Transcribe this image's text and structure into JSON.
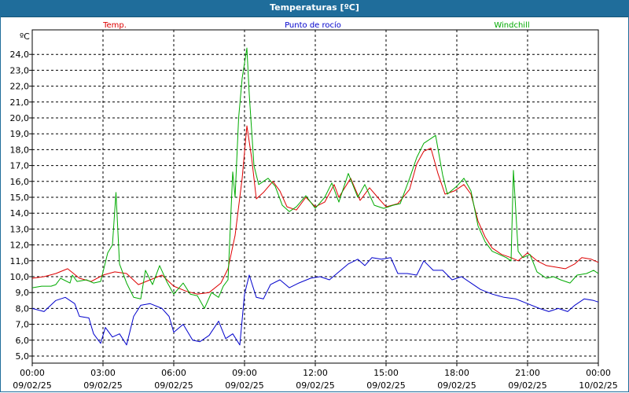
{
  "window": {
    "title": "Temperaturas [ºC]"
  },
  "chart_data": {
    "type": "line",
    "title": "Temperaturas [ºC]",
    "ylabel": "ºC",
    "ylim": [
      4.75,
      25.3
    ],
    "yticks": [
      "5,0",
      "6,0",
      "7,0",
      "8,0",
      "9,0",
      "10,0",
      "11,0",
      "12,0",
      "13,0",
      "14,0",
      "15,0",
      "16,0",
      "17,0",
      "18,0",
      "19,0",
      "20,0",
      "21,0",
      "22,0",
      "23,0",
      "24,0"
    ],
    "ytick_values": [
      5,
      6,
      7,
      8,
      9,
      10,
      11,
      12,
      13,
      14,
      15,
      16,
      17,
      18,
      19,
      20,
      21,
      22,
      23,
      24
    ],
    "xlim": [
      0,
      24
    ],
    "xtick_hours": [
      0,
      3,
      6,
      9,
      12,
      15,
      18,
      21,
      24
    ],
    "xticks": [
      {
        "time": "00:00",
        "date": "09/02/25"
      },
      {
        "time": "03:00",
        "date": "09/02/25"
      },
      {
        "time": "06:00",
        "date": "09/02/25"
      },
      {
        "time": "09:00",
        "date": "09/02/25"
      },
      {
        "time": "12:00",
        "date": "09/02/25"
      },
      {
        "time": "15:00",
        "date": "09/02/25"
      },
      {
        "time": "18:00",
        "date": "09/02/25"
      },
      {
        "time": "21:00",
        "date": "09/02/25"
      },
      {
        "time": "00:00",
        "date": "10/02/25"
      }
    ],
    "grid": true,
    "legend_position": "top",
    "series": [
      {
        "name": "Temp.",
        "color": "#dd0000",
        "points": [
          [
            0,
            9.9
          ],
          [
            0.5,
            10.0
          ],
          [
            1.0,
            10.2
          ],
          [
            1.5,
            10.5
          ],
          [
            2.0,
            9.9
          ],
          [
            2.5,
            9.7
          ],
          [
            3.0,
            10.1
          ],
          [
            3.5,
            10.3
          ],
          [
            4.0,
            10.2
          ],
          [
            4.5,
            9.5
          ],
          [
            5.0,
            9.8
          ],
          [
            5.5,
            10.1
          ],
          [
            6.0,
            9.4
          ],
          [
            6.5,
            9.1
          ],
          [
            7.0,
            8.9
          ],
          [
            7.5,
            9.0
          ],
          [
            8.0,
            9.6
          ],
          [
            8.3,
            10.5
          ],
          [
            8.6,
            12.6
          ],
          [
            8.9,
            16.2
          ],
          [
            9.1,
            19.5
          ],
          [
            9.3,
            17.5
          ],
          [
            9.5,
            14.9
          ],
          [
            9.8,
            15.3
          ],
          [
            10.2,
            16.0
          ],
          [
            10.5,
            15.4
          ],
          [
            10.8,
            14.4
          ],
          [
            11.2,
            14.2
          ],
          [
            11.6,
            15.0
          ],
          [
            12.0,
            14.4
          ],
          [
            12.4,
            14.7
          ],
          [
            12.8,
            15.8
          ],
          [
            13.0,
            15.0
          ],
          [
            13.5,
            16.2
          ],
          [
            13.9,
            14.8
          ],
          [
            14.3,
            15.6
          ],
          [
            14.7,
            14.9
          ],
          [
            15.0,
            14.4
          ],
          [
            15.5,
            14.6
          ],
          [
            16.0,
            15.5
          ],
          [
            16.3,
            17.1
          ],
          [
            16.6,
            17.9
          ],
          [
            16.9,
            18.1
          ],
          [
            17.2,
            16.5
          ],
          [
            17.5,
            15.2
          ],
          [
            17.9,
            15.4
          ],
          [
            18.3,
            15.8
          ],
          [
            18.6,
            15.2
          ],
          [
            18.9,
            13.5
          ],
          [
            19.2,
            12.5
          ],
          [
            19.5,
            11.8
          ],
          [
            19.9,
            11.4
          ],
          [
            20.3,
            11.2
          ],
          [
            20.6,
            11.0
          ],
          [
            21.0,
            11.5
          ],
          [
            21.4,
            11.0
          ],
          [
            21.8,
            10.7
          ],
          [
            22.2,
            10.6
          ],
          [
            22.6,
            10.5
          ],
          [
            23.0,
            10.8
          ],
          [
            23.3,
            11.2
          ],
          [
            23.7,
            11.1
          ],
          [
            24.0,
            10.9
          ]
        ]
      },
      {
        "name": "Punto de rocío",
        "color": "#0000cc",
        "points": [
          [
            0,
            8.0
          ],
          [
            0.5,
            7.8
          ],
          [
            1.0,
            8.5
          ],
          [
            1.4,
            8.7
          ],
          [
            1.8,
            8.3
          ],
          [
            2.0,
            7.5
          ],
          [
            2.4,
            7.4
          ],
          [
            2.6,
            6.4
          ],
          [
            2.9,
            5.8
          ],
          [
            3.1,
            6.8
          ],
          [
            3.4,
            6.2
          ],
          [
            3.7,
            6.4
          ],
          [
            4.0,
            5.7
          ],
          [
            4.3,
            7.5
          ],
          [
            4.6,
            8.2
          ],
          [
            5.0,
            8.3
          ],
          [
            5.5,
            8.0
          ],
          [
            5.8,
            7.5
          ],
          [
            6.0,
            6.5
          ],
          [
            6.4,
            7.0
          ],
          [
            6.8,
            6.0
          ],
          [
            7.1,
            5.9
          ],
          [
            7.5,
            6.3
          ],
          [
            7.9,
            7.2
          ],
          [
            8.2,
            6.1
          ],
          [
            8.5,
            6.4
          ],
          [
            8.8,
            5.7
          ],
          [
            9.0,
            8.9
          ],
          [
            9.2,
            10.1
          ],
          [
            9.5,
            8.7
          ],
          [
            9.8,
            8.6
          ],
          [
            10.1,
            9.5
          ],
          [
            10.5,
            9.8
          ],
          [
            10.9,
            9.3
          ],
          [
            11.3,
            9.6
          ],
          [
            11.8,
            9.9
          ],
          [
            12.2,
            10.0
          ],
          [
            12.6,
            9.8
          ],
          [
            13.0,
            10.3
          ],
          [
            13.4,
            10.8
          ],
          [
            13.8,
            11.1
          ],
          [
            14.1,
            10.7
          ],
          [
            14.4,
            11.2
          ],
          [
            14.8,
            11.1
          ],
          [
            15.2,
            11.2
          ],
          [
            15.5,
            10.2
          ],
          [
            15.9,
            10.2
          ],
          [
            16.3,
            10.1
          ],
          [
            16.6,
            11.0
          ],
          [
            17.0,
            10.4
          ],
          [
            17.4,
            10.4
          ],
          [
            17.8,
            9.8
          ],
          [
            18.2,
            10.0
          ],
          [
            18.6,
            9.6
          ],
          [
            19.0,
            9.2
          ],
          [
            19.5,
            8.9
          ],
          [
            20.0,
            8.7
          ],
          [
            20.5,
            8.6
          ],
          [
            21.0,
            8.3
          ],
          [
            21.5,
            8.0
          ],
          [
            21.9,
            7.8
          ],
          [
            22.3,
            8.0
          ],
          [
            22.7,
            7.8
          ],
          [
            23.0,
            8.2
          ],
          [
            23.4,
            8.6
          ],
          [
            23.8,
            8.5
          ],
          [
            24.0,
            8.4
          ]
        ]
      },
      {
        "name": "Windchill",
        "color": "#00aa00",
        "points": [
          [
            0,
            9.3
          ],
          [
            0.4,
            9.4
          ],
          [
            0.8,
            9.4
          ],
          [
            1.0,
            9.5
          ],
          [
            1.2,
            9.9
          ],
          [
            1.6,
            9.6
          ],
          [
            1.7,
            10.1
          ],
          [
            1.9,
            9.7
          ],
          [
            2.3,
            9.8
          ],
          [
            2.6,
            9.6
          ],
          [
            2.9,
            9.7
          ],
          [
            3.2,
            11.5
          ],
          [
            3.4,
            12.0
          ],
          [
            3.55,
            15.3
          ],
          [
            3.7,
            10.8
          ],
          [
            4.0,
            9.6
          ],
          [
            4.3,
            8.7
          ],
          [
            4.6,
            8.6
          ],
          [
            4.8,
            10.4
          ],
          [
            5.1,
            9.5
          ],
          [
            5.4,
            10.7
          ],
          [
            5.7,
            9.7
          ],
          [
            6.0,
            8.9
          ],
          [
            6.4,
            9.6
          ],
          [
            6.7,
            8.9
          ],
          [
            7.0,
            8.8
          ],
          [
            7.3,
            8.0
          ],
          [
            7.6,
            9.0
          ],
          [
            7.9,
            8.7
          ],
          [
            8.1,
            9.4
          ],
          [
            8.3,
            9.8
          ],
          [
            8.5,
            16.6
          ],
          [
            8.6,
            15.0
          ],
          [
            8.75,
            20.0
          ],
          [
            8.9,
            22.5
          ],
          [
            9.1,
            24.4
          ],
          [
            9.2,
            21.5
          ],
          [
            9.4,
            17.0
          ],
          [
            9.6,
            15.8
          ],
          [
            10.0,
            16.2
          ],
          [
            10.3,
            15.7
          ],
          [
            10.6,
            14.5
          ],
          [
            10.9,
            14.1
          ],
          [
            11.2,
            14.4
          ],
          [
            11.6,
            15.1
          ],
          [
            12.0,
            14.3
          ],
          [
            12.4,
            15.0
          ],
          [
            12.7,
            15.9
          ],
          [
            13.0,
            14.7
          ],
          [
            13.4,
            16.5
          ],
          [
            13.8,
            15.0
          ],
          [
            14.1,
            15.8
          ],
          [
            14.5,
            14.5
          ],
          [
            14.9,
            14.3
          ],
          [
            15.3,
            14.5
          ],
          [
            15.6,
            14.6
          ],
          [
            16.0,
            16.2
          ],
          [
            16.3,
            17.5
          ],
          [
            16.6,
            18.4
          ],
          [
            16.9,
            18.7
          ],
          [
            17.1,
            18.9
          ],
          [
            17.4,
            16.4
          ],
          [
            17.6,
            15.2
          ],
          [
            18.0,
            15.7
          ],
          [
            18.3,
            16.2
          ],
          [
            18.6,
            15.4
          ],
          [
            18.9,
            13.2
          ],
          [
            19.2,
            12.2
          ],
          [
            19.5,
            11.6
          ],
          [
            19.8,
            11.4
          ],
          [
            20.1,
            11.2
          ],
          [
            20.3,
            11.0
          ],
          [
            20.4,
            16.7
          ],
          [
            20.6,
            11.6
          ],
          [
            20.8,
            11.2
          ],
          [
            21.1,
            11.4
          ],
          [
            21.4,
            10.3
          ],
          [
            21.8,
            9.9
          ],
          [
            22.1,
            10.0
          ],
          [
            22.4,
            9.8
          ],
          [
            22.8,
            9.6
          ],
          [
            23.1,
            10.1
          ],
          [
            23.5,
            10.2
          ],
          [
            23.8,
            10.4
          ],
          [
            24.0,
            10.2
          ]
        ]
      }
    ]
  }
}
